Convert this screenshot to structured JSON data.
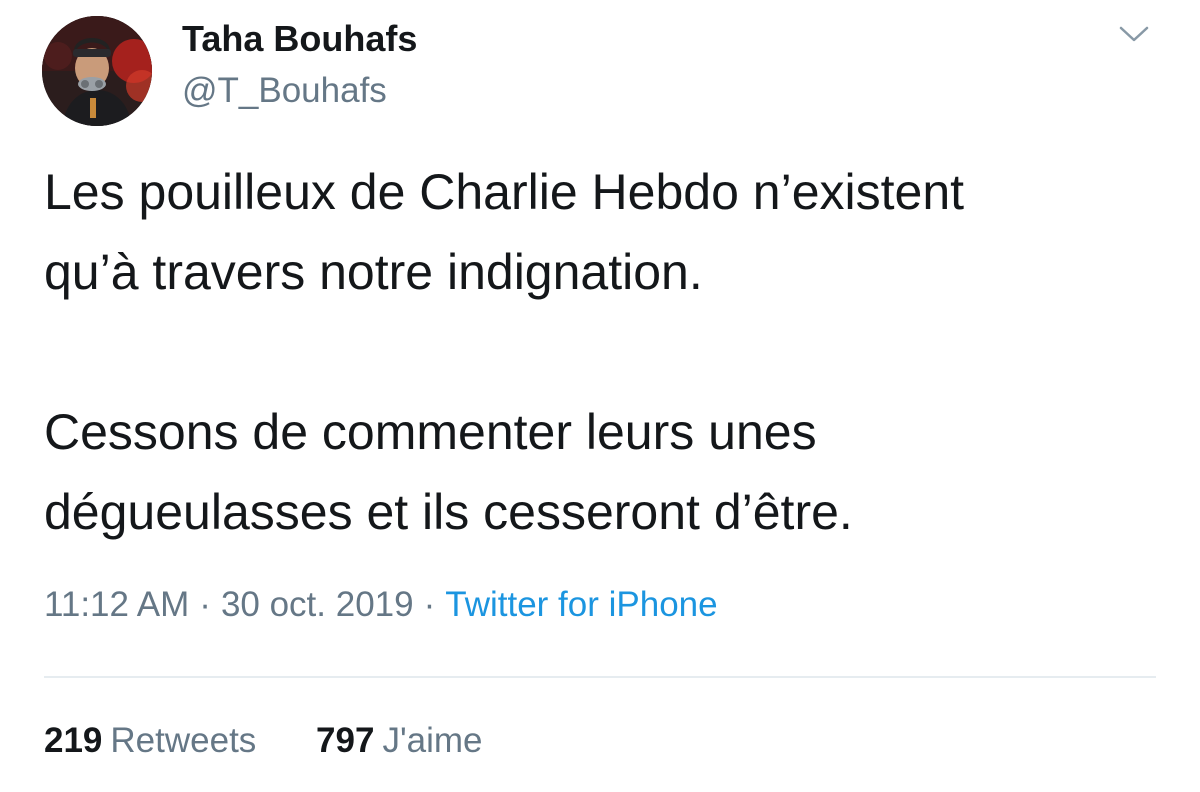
{
  "tweet": {
    "author": {
      "display_name": "Taha Bouhafs",
      "handle": "@T_Bouhafs"
    },
    "text": {
      "paragraph_1_line_1": "Les pouilleux de Charlie Hebdo n’existent",
      "paragraph_1_line_2": "qu’à travers notre indignation.",
      "paragraph_2_line_1": "Cessons de commenter leurs unes",
      "paragraph_2_line_2": "dégueulasses et ils cesseront d’être."
    },
    "meta": {
      "time": "11:12 AM",
      "separator": "·",
      "date": "30 oct. 2019",
      "source": "Twitter for iPhone"
    },
    "stats": {
      "retweets_count": "219",
      "retweets_label": "Retweets",
      "likes_count": "797",
      "likes_label": "J'aime"
    },
    "icons": {
      "more": "chevron-down-icon"
    },
    "colors": {
      "text": "#14171a",
      "secondary_text": "#657786",
      "link": "#1b95e0",
      "divider": "#e6ecf0"
    }
  }
}
